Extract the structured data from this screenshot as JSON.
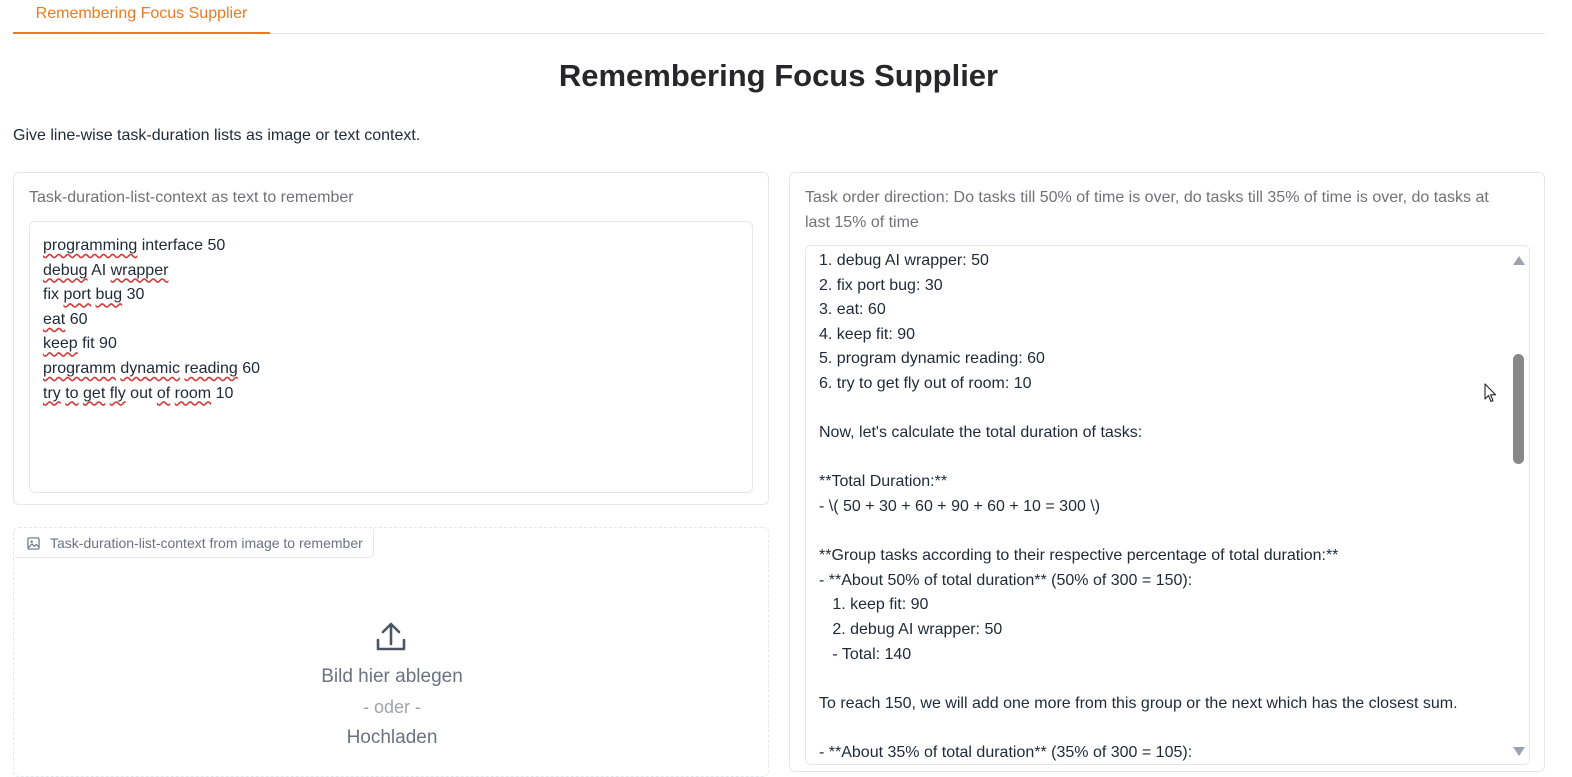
{
  "tab": {
    "label": "Remembering Focus Supplier"
  },
  "page": {
    "title": "Remembering Focus Supplier",
    "description": "Give line-wise task-duration lists as image or text context."
  },
  "text_input": {
    "label": "Task-duration-list-context as text to remember",
    "lines": [
      [
        "programming",
        " interface 50"
      ],
      [
        "debug",
        " AI ",
        "wrapper"
      ],
      [
        "fix ",
        "port",
        " ",
        "bug",
        " 30"
      ],
      [
        "eat",
        " 60"
      ],
      [
        "keep",
        " fit 90"
      ],
      [
        "programm",
        " ",
        "dynamic",
        " ",
        "reading",
        " 60"
      ],
      [
        "try",
        " ",
        "to",
        " ",
        "get",
        " ",
        "fly",
        " out ",
        "of",
        " ",
        "room",
        " 10"
      ]
    ]
  },
  "image_input": {
    "label": "Task-duration-list-context from image to remember",
    "drop_text": "Bild hier ablegen",
    "or_text": "- oder -",
    "upload_text": "Hochladen"
  },
  "output": {
    "label": "Task order direction: Do tasks till 50% of time is over, do tasks till 35% of time is over, do tasks at last 15% of time",
    "lines": [
      "1. debug AI wrapper: 50",
      "2. fix port bug: 30",
      "3. eat: 60",
      "4. keep fit: 90",
      "5. program dynamic reading: 60",
      "6. try to get fly out of room: 10",
      "",
      "Now, let's calculate the total duration of tasks:",
      "",
      "**Total Duration:**",
      "- \\( 50 + 30 + 60 + 90 + 60 + 10 = 300 \\)",
      "",
      "**Group tasks according to their respective percentage of total duration:**",
      "- **About 50% of total duration** (50% of 300 = 150):",
      "   1. keep fit: 90",
      "   2. debug AI wrapper: 50",
      "   - Total: 140",
      "",
      "To reach 150, we will add one more from this group or the next which has the closest sum.",
      "",
      "- **About 35% of total duration** (35% of 300 = 105):"
    ]
  }
}
